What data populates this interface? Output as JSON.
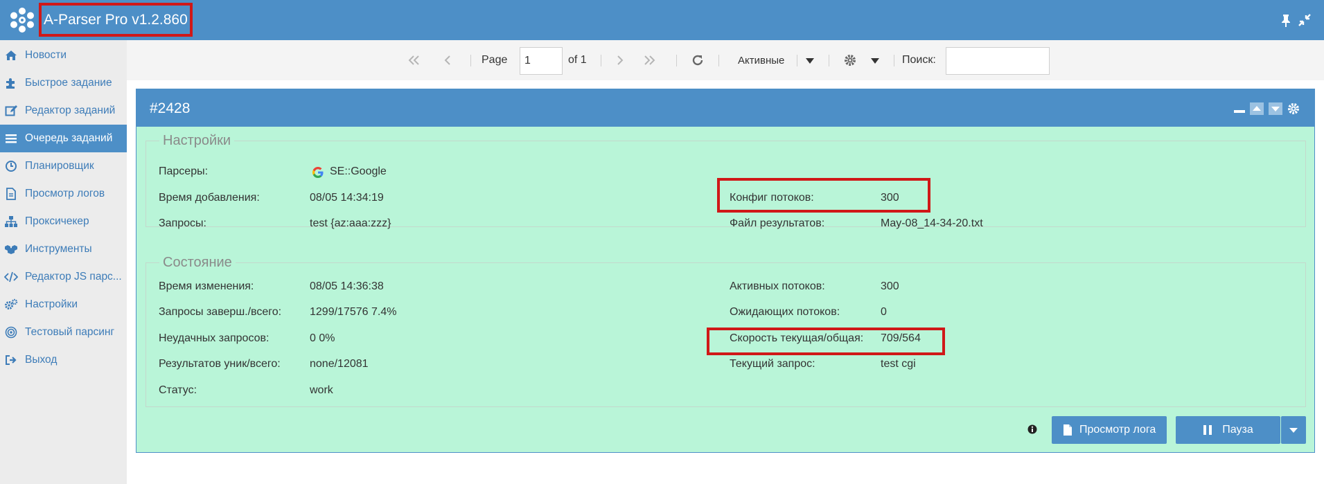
{
  "app": {
    "title": "A-Parser Pro v1.2.860"
  },
  "sidebar": {
    "items": [
      {
        "label": "Новости",
        "icon": "home-icon"
      },
      {
        "label": "Быстрое задание",
        "icon": "puzzle-icon"
      },
      {
        "label": "Редактор заданий",
        "icon": "edit-icon"
      },
      {
        "label": "Очередь заданий",
        "icon": "list-icon",
        "active": true
      },
      {
        "label": "Планировщик",
        "icon": "clock-icon"
      },
      {
        "label": "Просмотр логов",
        "icon": "file-icon"
      },
      {
        "label": "Проксичекер",
        "icon": "sitemap-icon"
      },
      {
        "label": "Инструменты",
        "icon": "cubes-icon"
      },
      {
        "label": "Редактор JS парс...",
        "icon": "code-icon"
      },
      {
        "label": "Настройки",
        "icon": "gears-icon"
      },
      {
        "label": "Тестовый парсинг",
        "icon": "target-icon"
      },
      {
        "label": "Выход",
        "icon": "sign-out-icon"
      }
    ]
  },
  "toolbar": {
    "page_label": "Page",
    "page_value": "1",
    "of_label": "of 1",
    "filter_label": "Активные",
    "search_label": "Поиск:",
    "search_value": ""
  },
  "task": {
    "id": "#2428",
    "settings": {
      "legend": "Настройки",
      "parsers_label": "Парсеры:",
      "parsers_value": "SE::Google",
      "added_label": "Время добавления:",
      "added_value": "08/05 14:34:19",
      "queries_label": "Запросы:",
      "queries_value": "test {az:aaa:zzz}",
      "threads_config_label": "Конфиг потоков:",
      "threads_config_value": "300",
      "result_file_label": "Файл результатов:",
      "result_file_value": "May-08_14-34-20.txt"
    },
    "state": {
      "legend": "Состояние",
      "changed_label": "Время изменения:",
      "changed_value": "08/05 14:36:38",
      "done_label": "Запросы заверш./всего:",
      "done_value": "1299/17576 7.4%",
      "failed_label": "Неудачных запросов:",
      "failed_value": "0 0%",
      "results_label": "Результатов уник/всего:",
      "results_value": "none/12081",
      "status_label": "Статус:",
      "status_value": "work",
      "active_threads_label": "Активных потоков:",
      "active_threads_value": "300",
      "waiting_threads_label": "Ожидающих потоков:",
      "waiting_threads_value": "0",
      "speed_label": "Скорость текущая/общая:",
      "speed_value": "709/564",
      "current_query_label": "Текущий запрос:",
      "current_query_value": "test cgi"
    },
    "buttons": {
      "view_log": "Просмотр лога",
      "pause": "Пауза"
    }
  },
  "colors": {
    "accent": "#4d8fc7",
    "panel_bg": "#b9f5d8",
    "highlight": "#d01818",
    "link": "#3d7cb8"
  }
}
